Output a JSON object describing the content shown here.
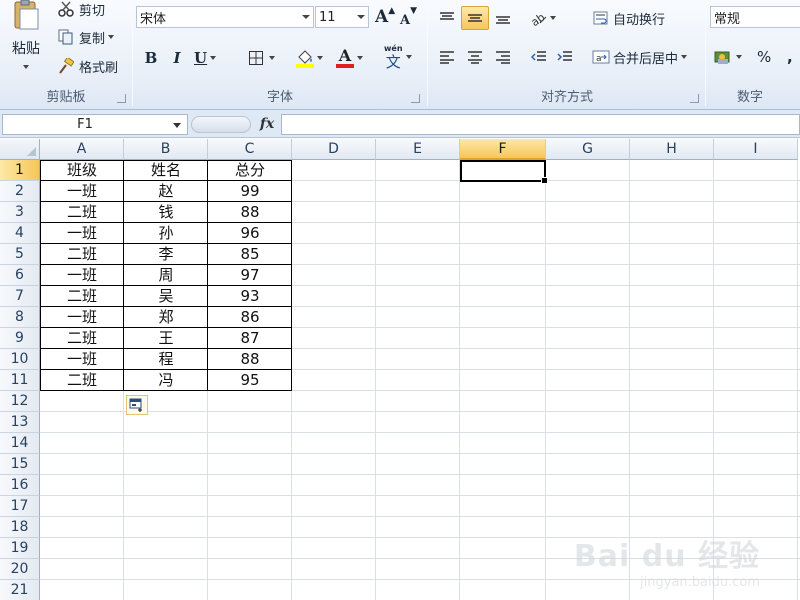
{
  "ribbon": {
    "clipboard": {
      "label": "剪贴板",
      "paste": "粘贴",
      "cut": "剪切",
      "copy": "复制",
      "format_painter": "格式刷"
    },
    "font": {
      "label": "字体",
      "font_name": "宋体",
      "font_size": "11",
      "bold": "B",
      "italic": "I",
      "underline": "U",
      "grow": "A",
      "shrink": "A",
      "font_color_letter": "A",
      "phonetic": "文",
      "phonetic_small": "wén"
    },
    "alignment": {
      "label": "对齐方式",
      "wrap_text": "自动换行",
      "merge_center": "合并后居中"
    },
    "number": {
      "label": "数字",
      "format": "常规",
      "percent": "%"
    }
  },
  "formula_bar": {
    "name_box": "F1",
    "fx": "fx",
    "formula": ""
  },
  "grid": {
    "columns": [
      "A",
      "B",
      "C",
      "D",
      "E",
      "F",
      "G",
      "H",
      "I"
    ],
    "active_column": "F",
    "rows": [
      "1",
      "2",
      "3",
      "4",
      "5",
      "6",
      "7",
      "8",
      "9",
      "10",
      "11",
      "12",
      "13",
      "14",
      "15",
      "16",
      "17",
      "18",
      "19",
      "20",
      "21"
    ],
    "active_row": "1",
    "data": [
      [
        "班级",
        "姓名",
        "总分"
      ],
      [
        "一班",
        "赵",
        "99"
      ],
      [
        "二班",
        "钱",
        "88"
      ],
      [
        "一班",
        "孙",
        "96"
      ],
      [
        "二班",
        "李",
        "85"
      ],
      [
        "一班",
        "周",
        "97"
      ],
      [
        "二班",
        "吴",
        "93"
      ],
      [
        "一班",
        "郑",
        "86"
      ],
      [
        "二班",
        "王",
        "87"
      ],
      [
        "一班",
        "程",
        "88"
      ],
      [
        "二班",
        "冯",
        "95"
      ]
    ]
  },
  "watermark": {
    "logo": "Bai du 经验",
    "sub": "jingyan.baidu.com"
  },
  "colors": {
    "accent_highlight": "#f7c65a",
    "font_color_bar": "#e02020",
    "fill_color_bar": "#ffff00"
  }
}
